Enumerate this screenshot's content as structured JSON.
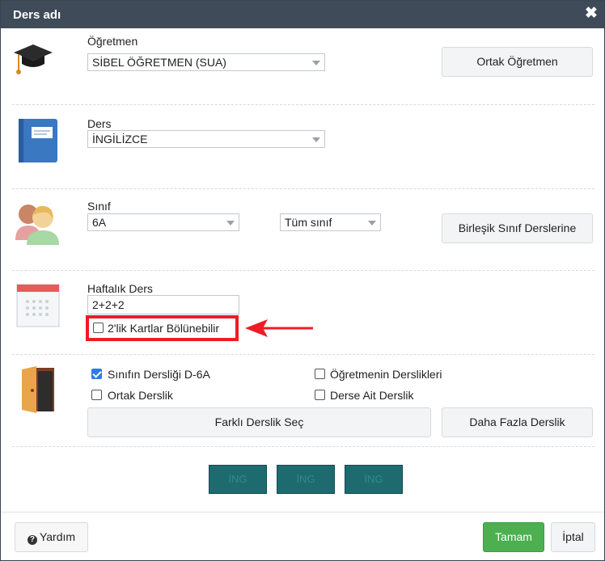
{
  "window": {
    "title": "Ders adı"
  },
  "teacher": {
    "label": "Öğretmen",
    "value": "SİBEL ÖĞRETMEN (SUA)",
    "shared_button": "Ortak Öğretmen"
  },
  "subject": {
    "label": "Ders",
    "value": "İNGİLİZCE"
  },
  "class": {
    "label": "Sınıf",
    "value": "6A",
    "group_value": "Tüm sınıf",
    "joint_button": "Birleşik Sınıf Derslerine"
  },
  "weekly": {
    "label": "Haftalık Ders",
    "value": "2+2+2",
    "split_checkbox": "2'lik Kartlar Bölünebilir"
  },
  "rooms": {
    "class_room": "Sınıfın Dersliği D-6A",
    "teacher_rooms": "Öğretmenin Derslikleri",
    "shared_room": "Ortak Derslik",
    "subject_room": "Derse Ait Derslik",
    "choose_button": "Farklı Derslik Seç",
    "more_button": "Daha Fazla Derslik"
  },
  "cards": [
    "İNG",
    "İNG",
    "İNG"
  ],
  "footer": {
    "help": "Yardım",
    "ok": "Tamam",
    "cancel": "İptal"
  },
  "colors": {
    "titlebar": "#3f4b58",
    "ok_button": "#4caf50",
    "card": "#1e6b6f",
    "highlight": "#ee1c25",
    "checkbox_on": "#2a7de1"
  }
}
